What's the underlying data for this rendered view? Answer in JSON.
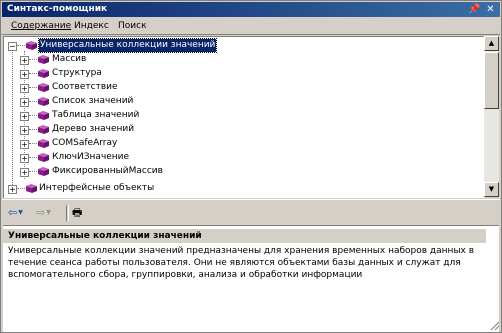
{
  "window": {
    "title": "Синтакс-помощник",
    "pin_glyph": "📌",
    "close_glyph": "✕"
  },
  "menu": {
    "items": [
      "Содержание",
      "Индекс",
      "Поиск"
    ]
  },
  "tree": {
    "root": {
      "label": "Универсальные коллекции значений",
      "expander": "−"
    },
    "children": [
      {
        "label": "Массив",
        "expander": "+"
      },
      {
        "label": "Структура",
        "expander": "+"
      },
      {
        "label": "Соответствие",
        "expander": "+"
      },
      {
        "label": "Список значений",
        "expander": "+"
      },
      {
        "label": "Таблица значений",
        "expander": "+"
      },
      {
        "label": "Дерево значений",
        "expander": "+"
      },
      {
        "label": "COMSafeArray",
        "expander": "+"
      },
      {
        "label": "КлючИЗначение",
        "expander": "+"
      },
      {
        "label": "ФиксированныйМассив",
        "expander": "+"
      }
    ],
    "next_root": {
      "label": "Интерфейсные объекты",
      "expander": "+"
    }
  },
  "toolbar": {
    "back_glyph": "⇦",
    "forward_glyph": "⇨",
    "dropdown_glyph": "▼",
    "print_glyph": "🖶"
  },
  "help": {
    "title": "Универсальные коллекции значений",
    "text": "Универсальные коллекции значений предназначены для хранения временных наборов данных в течение сеанса работы пользователя. Они не являются объектами базы данных и служат для вспомогательного сбора, группировки, анализа и обработки информации"
  },
  "colors": {
    "book_icon": "#8b1a8b",
    "selection": "#0a246a",
    "titlebar": "#0a246a"
  }
}
